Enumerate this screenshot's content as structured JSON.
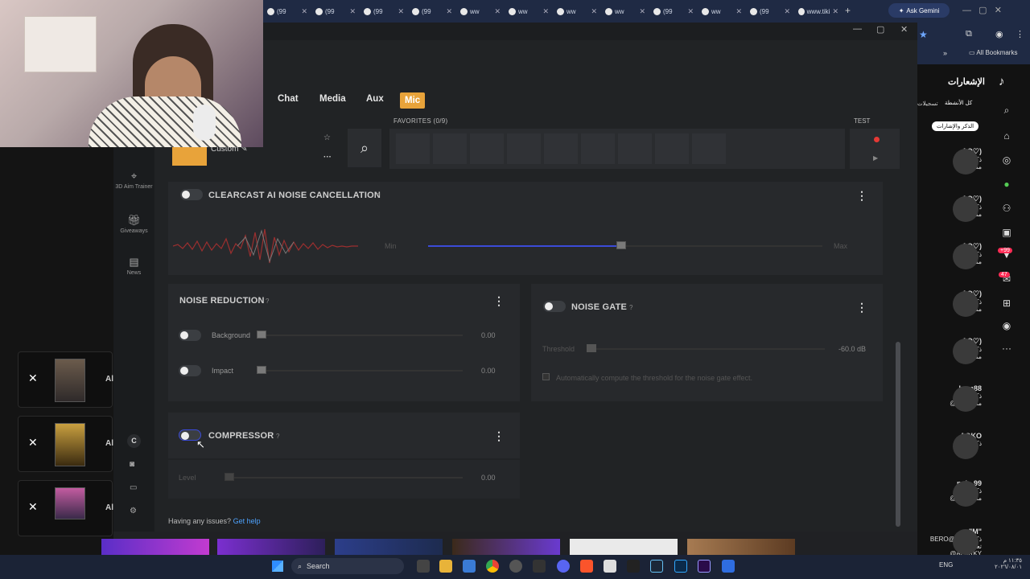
{
  "browser": {
    "tabs": [
      {
        "label": "(99",
        "icon": "tiktok-icon"
      },
      {
        "label": "(99",
        "icon": "tiktok-icon"
      },
      {
        "label": "(99",
        "icon": "tiktok-icon"
      },
      {
        "label": "(99",
        "icon": "tiktok-icon"
      },
      {
        "label": "ww",
        "icon": "globe-icon"
      },
      {
        "label": "ww",
        "icon": "globe-icon"
      },
      {
        "label": "ww",
        "icon": "globe-icon"
      },
      {
        "label": "ww",
        "icon": "globe-icon"
      },
      {
        "label": "(99",
        "icon": "tiktok-icon"
      },
      {
        "label": "ww",
        "icon": "globe-icon"
      },
      {
        "label": "(99",
        "icon": "tiktok-icon"
      },
      {
        "label": "www.tiki",
        "icon": "globe-icon"
      }
    ],
    "new_tab": "+",
    "ask_gemini": "Ask Gemini",
    "all_bookmarks": "All Bookmarks"
  },
  "nav": {
    "tabs": [
      "Chat",
      "Media",
      "Aux",
      "Mic"
    ],
    "active_tab": "Mic"
  },
  "preset": {
    "label": "Custom"
  },
  "favorites": {
    "label": "FAVORITES (0/9)",
    "slots": 9
  },
  "test": {
    "label": "TEST"
  },
  "sidebar": {
    "items": [
      {
        "icon": "crosshair-icon",
        "label": "3D Aim Trainer"
      },
      {
        "icon": "gift-icon",
        "label": "Giveaways"
      },
      {
        "icon": "news-icon",
        "label": "News"
      }
    ],
    "bottom": [
      "C"
    ]
  },
  "clearcast": {
    "title": "CLEARCAST AI NOISE CANCELLATION",
    "help": "?",
    "min_label": "Min",
    "max_label": "Max",
    "level": 0.49
  },
  "noise_reduction": {
    "title": "NOISE REDUCTION",
    "help": "?",
    "rows": [
      {
        "label": "Background",
        "value": "0.00"
      },
      {
        "label": "Impact",
        "value": "0.00"
      }
    ]
  },
  "noise_gate": {
    "title": "NOISE GATE",
    "help": "?",
    "threshold_label": "Threshold",
    "threshold_value": "-60.0 dB",
    "auto_label": "Automatically compute the threshold for the noise gate effect."
  },
  "compressor": {
    "title": "COMPRESSOR",
    "help": "?",
    "level_label": "Level",
    "level_value": "0.00"
  },
  "footer": {
    "issues": "Having any issues?",
    "help_link": "Get help"
  },
  "tiktok": {
    "title": "الإشعارات",
    "filters": [
      "كل الأنشطة",
      "تسجيلات",
      "الذكر والإشارات"
    ],
    "entries": [
      {
        "name": "AO♡)",
        "text": "ذكرك في",
        "time": "منذ 3 د"
      },
      {
        "name": "AO♡)",
        "text": "ذكرك في",
        "time": "منذ 3 د"
      },
      {
        "name": "AO♡)",
        "text": "ذكرك في",
        "time": "منذ 4 د"
      },
      {
        "name": "AO♡)",
        "text": "ذكرك في",
        "time": "منذ 4 د"
      },
      {
        "name": "AO♡)",
        "text": "ذكرك في",
        "time": "منذ 4 د"
      },
      {
        "name": "ham88",
        "text": "ذكرك في",
        "time": "@مستشفى"
      },
      {
        "name": "AOKO",
        "text": "ذكرك في",
        "time": ""
      },
      {
        "name": "nab_99",
        "text": "ذكرك في",
        "time": "@مستشفى"
      },
      {
        "name": "\"M\"",
        "text": "BERO@ ذكرك في تعليق",
        "time": "@ALKRKY"
      }
    ],
    "badges": [
      "+99",
      "47"
    ]
  },
  "taskbar": {
    "search": "Search",
    "lang": "ENG",
    "time": "١١:٣٥ م",
    "date": "٢٠٢٦/٠٨/٠١"
  },
  "colors": {
    "accent": "#e8a33a",
    "slider": "#3b4bd8",
    "record": "#e53935"
  }
}
